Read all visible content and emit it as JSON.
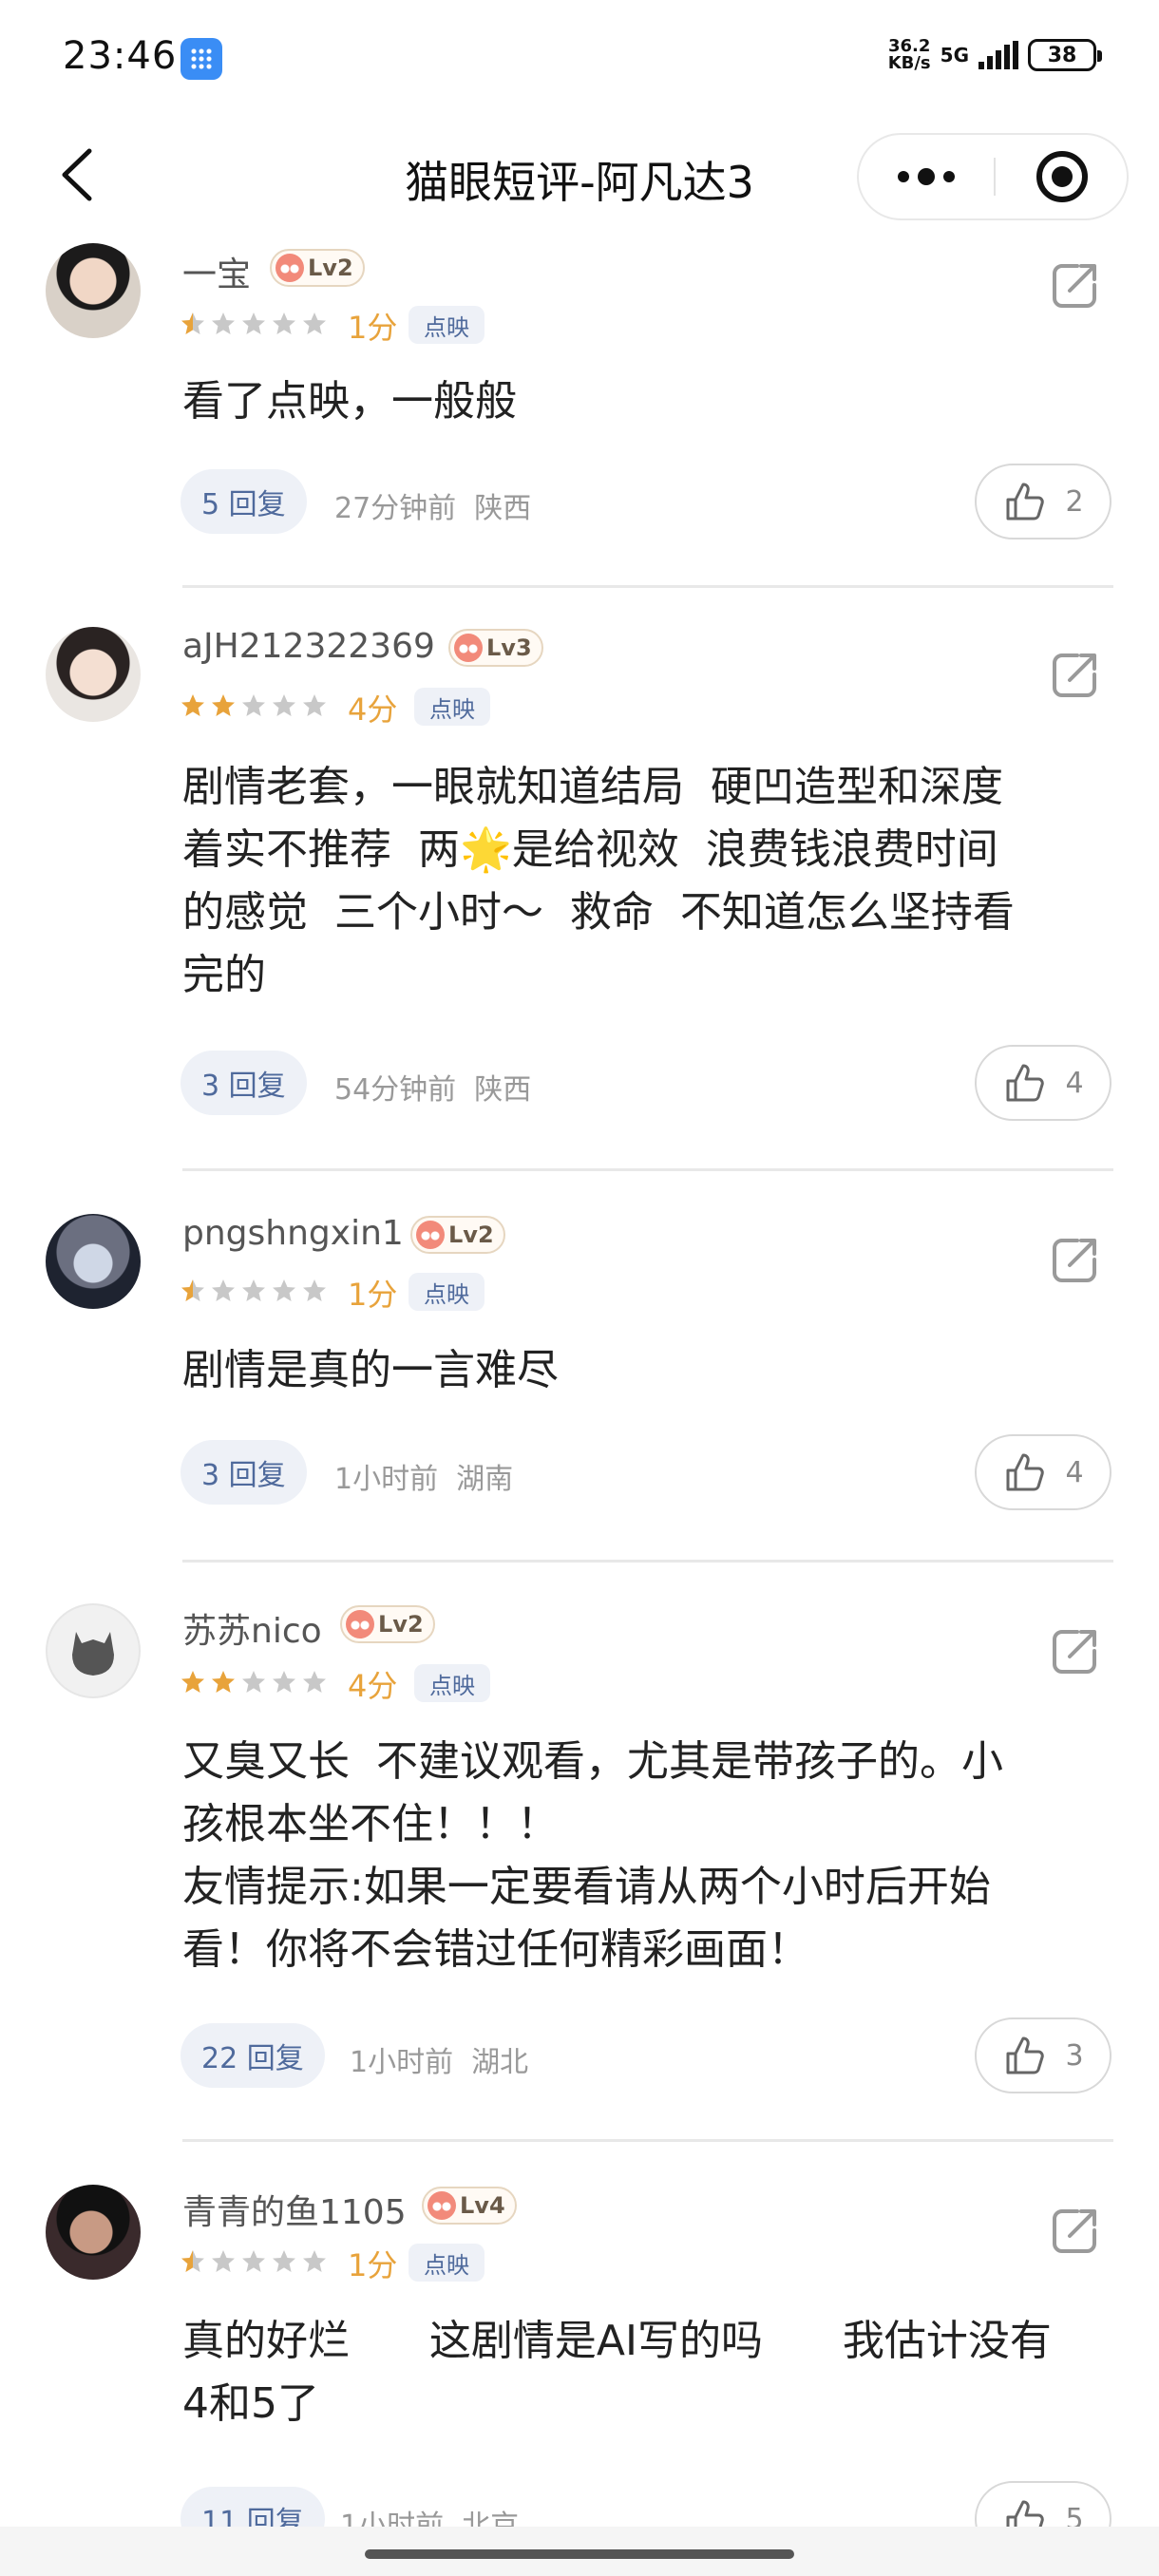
{
  "status_bar": {
    "time": "23:46",
    "net_speed_value": "36.2",
    "net_speed_unit": "KB/s",
    "signal": "5G",
    "battery": "38"
  },
  "nav": {
    "title": "猫眼短评-阿凡达3"
  },
  "colors": {
    "accent_star": "#e8a33b",
    "reply_text": "#4f6a9c",
    "reply_bg": "#eef1f7"
  },
  "comments": [
    {
      "user": "一宝",
      "level": "Lv2",
      "score": "1分",
      "rating_stars": 0.5,
      "tag": "点映",
      "content": "看了点映，一般般",
      "replies": "5 回复",
      "time": "27分钟前",
      "location": "陕西",
      "likes": "2"
    },
    {
      "user": "aJH212322369",
      "level": "Lv3",
      "score": "4分",
      "rating_stars": 2,
      "tag": "点映",
      "content": "剧情老套，一眼就知道结局  硬凹造型和深度\n着实不推荐  两🌟是给视效  浪费钱浪费时间\n的感觉  三个小时～  救命  不知道怎么坚持看\n完的",
      "replies": "3 回复",
      "time": "54分钟前",
      "location": "陕西",
      "likes": "4"
    },
    {
      "user": "pngshngxin1",
      "level": "Lv2",
      "score": "1分",
      "rating_stars": 0.5,
      "tag": "点映",
      "content": "剧情是真的一言难尽",
      "replies": "3 回复",
      "time": "1小时前",
      "location": "湖南",
      "likes": "4"
    },
    {
      "user": "苏苏nico",
      "level": "Lv2",
      "score": "4分",
      "rating_stars": 2,
      "tag": "点映",
      "content": "又臭又长  不建议观看，尤其是带孩子的。小\n孩根本坐不住！！！\n友情提示:如果一定要看请从两个小时后开始\n看！你将不会错过任何精彩画面！",
      "replies": "22 回复",
      "time": "1小时前",
      "location": "湖北",
      "likes": "3"
    },
    {
      "user": "青青的鱼1105",
      "level": "Lv4",
      "score": "1分",
      "rating_stars": 0.5,
      "tag": "点映",
      "content": "真的好烂      这剧情是AI写的吗      我估计没有\n4和5了",
      "replies": "11 回复",
      "time": "1小时前",
      "location": "北京",
      "likes": "5"
    }
  ]
}
